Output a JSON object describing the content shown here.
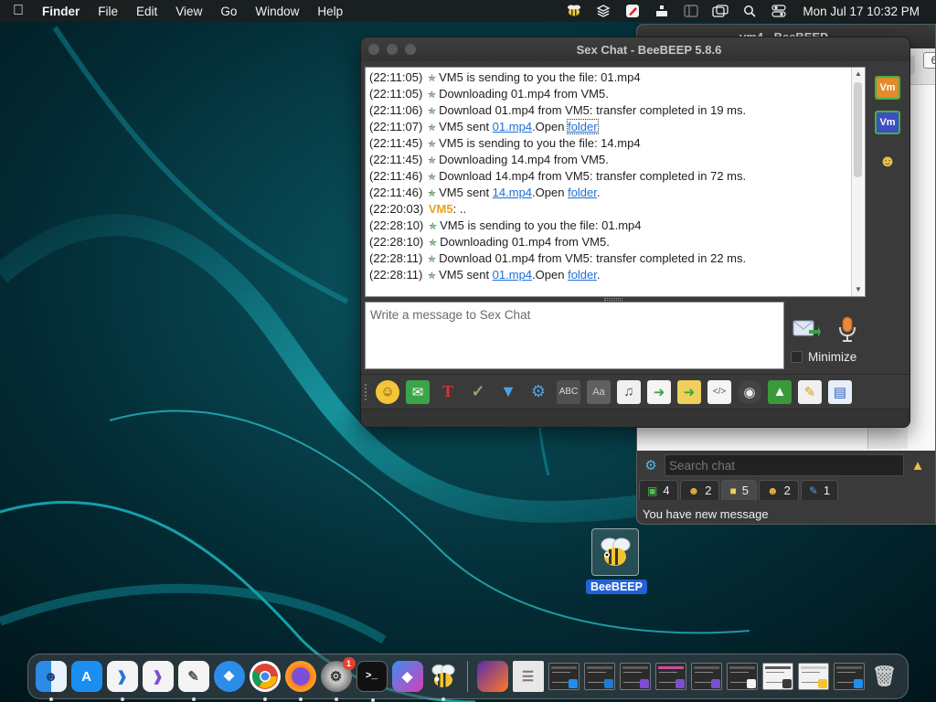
{
  "menubar": {
    "app_name": "Finder",
    "menus": [
      "File",
      "Edit",
      "View",
      "Go",
      "Window",
      "Help"
    ],
    "status_icons": [
      "beebeep-icon",
      "layers-icon",
      "pen-icon",
      "stack-icon",
      "sidebar-icon",
      "screens-icon",
      "search-icon",
      "control-center-icon"
    ],
    "clock": "Mon Jul 17  10:32 PM"
  },
  "background_window": {
    "title": "vm4 - BeeBEEP",
    "close_label": "6",
    "search": {
      "placeholder": "Search chat",
      "value": ""
    },
    "tabs": [
      {
        "icon": "monitor-icon",
        "count": "4"
      },
      {
        "icon": "users-icon",
        "count": "2"
      },
      {
        "icon": "chat-folder-icon",
        "count": "5"
      },
      {
        "icon": "groups-icon",
        "count": "2"
      },
      {
        "icon": "log-icon",
        "count": "1"
      }
    ],
    "status": "You have new message",
    "vm_tiles": [
      "Vm",
      "Vm"
    ]
  },
  "chat_window": {
    "title": "Sex Chat - BeeBEEP 5.8.6",
    "messages": [
      {
        "ts": "(22:11:05)",
        "pre": "VM5 is sending to you the file: 01.mp4",
        "link1": "",
        "mid": "",
        "link2": "",
        "post": ""
      },
      {
        "ts": "(22:11:05)",
        "pre": "Downloading 01.mp4 from VM5.",
        "link1": "",
        "mid": "",
        "link2": "",
        "post": ""
      },
      {
        "ts": "(22:11:06)",
        "pre": "Download 01.mp4 from VM5: transfer completed in 19 ms.",
        "link1": "",
        "mid": "",
        "link2": "",
        "post": ""
      },
      {
        "ts": "(22:11:07)",
        "pre": "VM5 sent ",
        "link1": "01.mp4",
        "mid": ".Open ",
        "link2": "folder",
        "post": ""
      },
      {
        "ts": "(22:11:45)",
        "pre": "VM5 is sending to you the file: 14.mp4",
        "link1": "",
        "mid": "",
        "link2": "",
        "post": ""
      },
      {
        "ts": "(22:11:45)",
        "pre": "Downloading 14.mp4 from VM5.",
        "link1": "",
        "mid": "",
        "link2": "",
        "post": ""
      },
      {
        "ts": "(22:11:46)",
        "pre": "Download 14.mp4 from VM5: transfer completed in 72 ms.",
        "link1": "",
        "mid": "",
        "link2": "",
        "post": ""
      },
      {
        "ts": "(22:11:46)",
        "pre": "VM5 sent ",
        "link1": "14.mp4",
        "mid": ".Open ",
        "link2": "folder",
        "post": "."
      },
      {
        "ts": "(22:20:03)",
        "user": "VM5",
        "text": ": .."
      },
      {
        "ts": "(22:28:10)",
        "pre": "VM5 is sending to you the file: 01.mp4",
        "link1": "",
        "mid": "",
        "link2": "",
        "post": ""
      },
      {
        "ts": "(22:28:10)",
        "pre": "Downloading 01.mp4 from VM5.",
        "link1": "",
        "mid": "",
        "link2": "",
        "post": ""
      },
      {
        "ts": "(22:28:11)",
        "pre": "Download 01.mp4 from VM5: transfer completed in 22 ms.",
        "link1": "",
        "mid": "",
        "link2": "",
        "post": ""
      },
      {
        "ts": "(22:28:11)",
        "pre": "VM5 sent ",
        "link1": "01.mp4",
        "mid": ".Open ",
        "link2": "folder",
        "post": "."
      }
    ],
    "input": {
      "placeholder": "Write a message to Sex Chat",
      "value": ""
    },
    "minimize_label": "Minimize",
    "toolbar_icons": [
      "emoji-icon",
      "envelope-icon",
      "font-icon",
      "color-icon",
      "filter-icon",
      "settings-icon",
      "spellcheck-icon",
      "font-size-icon",
      "note-icon",
      "export-icon",
      "folder-icon",
      "html-icon",
      "screenshot-icon",
      "image-icon",
      "edit-icon",
      "save-icon"
    ],
    "vm_tiles": [
      "Vm",
      "Vm"
    ]
  },
  "desktop_icon": {
    "label": "BeeBEEP"
  },
  "dock": {
    "apps": [
      {
        "name": "finder",
        "running": true,
        "color": "#2f8fe8"
      },
      {
        "name": "app-store",
        "running": false,
        "color": "#1f8ef0"
      },
      {
        "name": "vscode",
        "running": true,
        "color": "#f4f4f4"
      },
      {
        "name": "visual-studio",
        "running": false,
        "color": "#f4f4f4"
      },
      {
        "name": "textedit",
        "running": true,
        "color": "#f0f0f0"
      },
      {
        "name": "safari",
        "running": false,
        "color": "#2c8de8"
      },
      {
        "name": "chrome",
        "running": true,
        "color": "#ffffff"
      },
      {
        "name": "firefox",
        "running": true,
        "color": "#1f1b3a"
      },
      {
        "name": "system-settings",
        "running": true,
        "color": "#8a8a8a",
        "badge": "1"
      },
      {
        "name": "terminal",
        "running": true,
        "color": "#1a1a1a"
      },
      {
        "name": "shortcuts",
        "running": false,
        "color": "#4b4fd6"
      },
      {
        "name": "beebeep",
        "running": true,
        "color": "transparent"
      }
    ],
    "recent": [
      "firefox",
      "document"
    ],
    "minimized_windows": 9
  }
}
